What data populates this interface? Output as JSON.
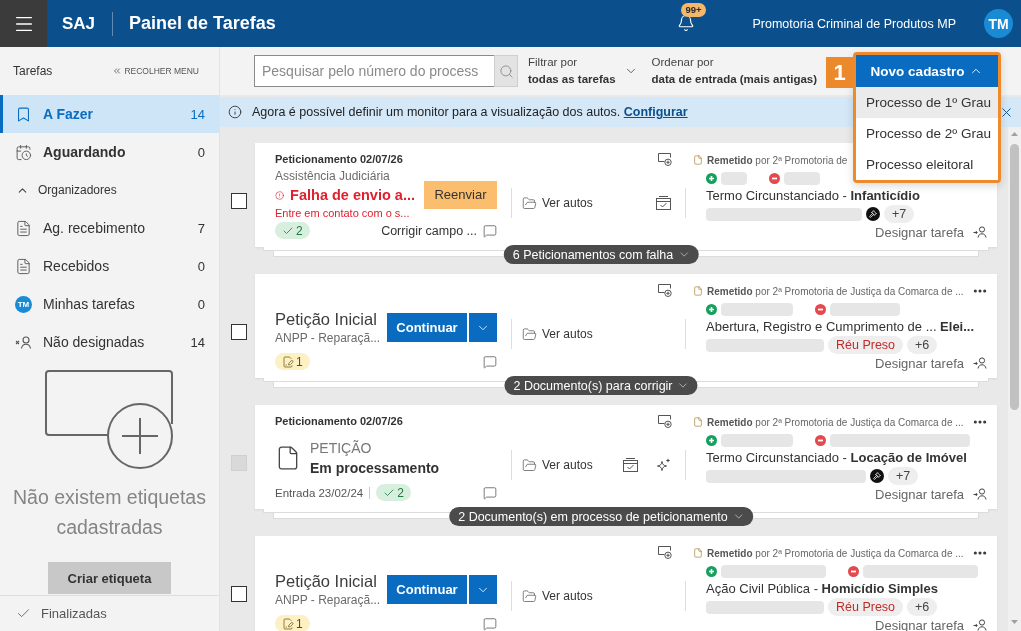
{
  "header": {
    "app": "SAJ",
    "title": "Painel de Tarefas",
    "notifications": "99+",
    "user": "Promotoria Criminal de Produtos MP",
    "avatar": "TM"
  },
  "sidebar": {
    "title": "Tarefas",
    "collapse": "RECOLHER MENU",
    "items": [
      {
        "kind": "todo",
        "label": "A Fazer",
        "count": "14",
        "selected": true
      },
      {
        "kind": "waiting",
        "label": "Aguardando",
        "count": "0",
        "selected": false
      }
    ],
    "organizers": {
      "label": "Organizadores",
      "expanded": true,
      "items": [
        {
          "kind": "inbox",
          "label": "Ag. recebimento",
          "count": "7",
          "selected": false
        },
        {
          "kind": "inbox",
          "label": "Recebidos",
          "count": "0",
          "selected": false
        },
        {
          "kind": "mine",
          "label": "Minhas tarefas",
          "avatar": "TM",
          "count": "0",
          "selected": false
        },
        {
          "kind": "unassigned",
          "label": "Não designadas",
          "count": "14",
          "selected": false
        }
      ]
    },
    "empty_tags": {
      "message": "Não existem etiquetas cadastradas",
      "button": "Criar etiqueta"
    },
    "footer": {
      "label": "Finalizadas"
    }
  },
  "toolbar": {
    "search": {
      "placeholder": "Pesquisar pelo número do process"
    },
    "filter": {
      "label": "Filtrar por",
      "value": "todas as tarefas"
    },
    "sort": {
      "label": "Ordenar por",
      "value": "data de entrada (mais antigas)"
    },
    "callout": "1",
    "new_button": {
      "label": "Novo cadastro",
      "expanded": true,
      "menu": [
        {
          "label": "Processo de 1º Grau",
          "selected": true
        },
        {
          "label": "Processo de 2º Grau",
          "selected": false
        },
        {
          "label": "Processo eleitoral",
          "selected": false
        }
      ]
    }
  },
  "banner": {
    "message": "Agora é possível definir um monitor para a visualização dos autos.",
    "link": "Configurar"
  },
  "cards": [
    {
      "kind": "failed",
      "checked": false,
      "disabled": false,
      "header": "Peticionamento 02/07/26",
      "subtitle": "Assistência Judiciária",
      "error": "Falha de envio a...",
      "error_detail": "Entre em contato com o s...",
      "action": "Reenviar",
      "badge": {
        "kind": "done",
        "label": "2"
      },
      "note": "Corrigir campo ...",
      "view": "Ver autos",
      "autos_checked": true,
      "ai_suggestion": false,
      "sender": "**Remetido** por 2ª Promotoria de",
      "more_menu": false,
      "subject": "Termo Circunstanciado - **Infanticídio**",
      "tags": [
        {
          "kind": "marker"
        },
        {
          "kind": "count",
          "label": "+7"
        }
      ],
      "assign": "Designar tarefa",
      "group": "6 Peticionamentos com falha"
    },
    {
      "kind": "draft",
      "checked": false,
      "disabled": false,
      "title": "Petição Inicial",
      "subtitle": "ANPP - Reparaçã...",
      "action": "Continuar",
      "badge": {
        "kind": "edit",
        "label": "1"
      },
      "view": "Ver autos",
      "autos_checked": false,
      "ai_suggestion": false,
      "sender": "**Remetido** por 2ª Promotoria de Justiça da Comarca de ...",
      "more_menu": true,
      "subject": "Abertura, Registro e Cumprimento de ...  **Elei...**",
      "tags": [
        {
          "kind": "alert",
          "label": "Réu Preso"
        },
        {
          "kind": "count",
          "label": "+6"
        }
      ],
      "assign": "Designar tarefa",
      "group": "2 Documento(s) para corrigir"
    },
    {
      "kind": "processing",
      "checked": false,
      "disabled": true,
      "header": "Peticionamento 02/07/26",
      "doc_type": "PETIÇÃO",
      "status": "Em processamento",
      "entry": "Entrada 23/02/24",
      "badge": {
        "kind": "done",
        "label": "2"
      },
      "view": "Ver autos",
      "autos_checked": true,
      "ai_suggestion": true,
      "sender": "**Remetido** por 2ª Promotoria de Justiça da Comarca de ...",
      "more_menu": true,
      "subject": "Termo Circunstanciado - **Locação de Imóvel**",
      "tags": [
        {
          "kind": "marker"
        },
        {
          "kind": "count",
          "label": "+7"
        }
      ],
      "assign": "Designar tarefa",
      "group": "2 Documento(s) em processo de peticionamento"
    },
    {
      "kind": "draft",
      "checked": false,
      "disabled": false,
      "title": "Petição Inicial",
      "subtitle": "ANPP - Reparaçã...",
      "action": "Continuar",
      "badge": {
        "kind": "edit",
        "label": "1"
      },
      "view": "Ver autos",
      "autos_checked": false,
      "ai_suggestion": false,
      "sender": "**Remetido** por 2ª Promotoria de Justiça da Comarca de ...",
      "more_menu": true,
      "subject": "Ação Civil Pública - **Homicídio Simples**",
      "tags": [
        {
          "kind": "alert",
          "label": "Réu Preso"
        },
        {
          "kind": "count",
          "label": "+6"
        }
      ],
      "assign": "Designar tarefa"
    }
  ]
}
